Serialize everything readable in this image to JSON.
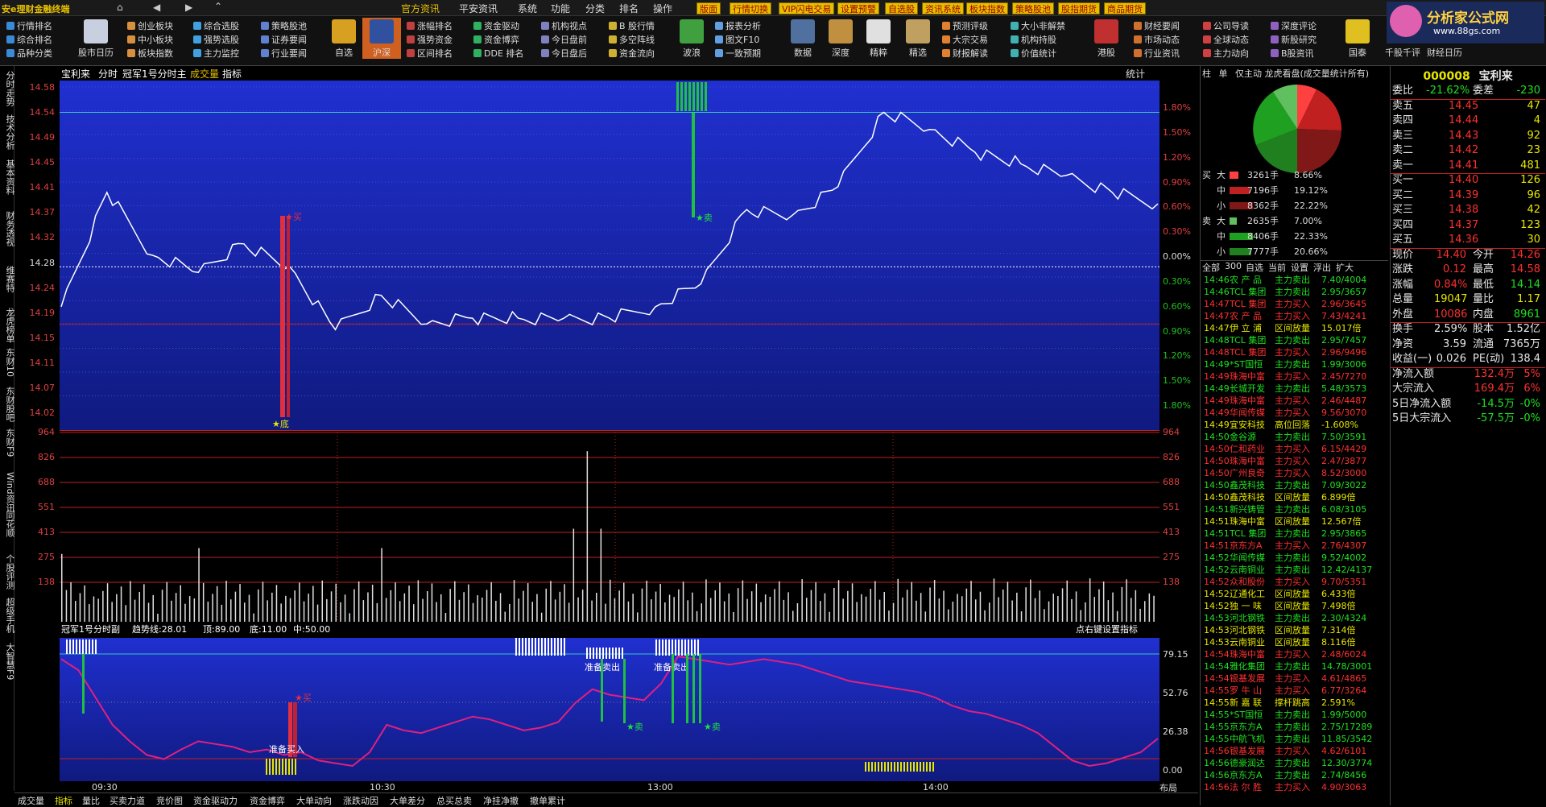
{
  "app": {
    "title": "安e理财金融终端",
    "menu": [
      "官方资讯",
      "平安资讯",
      "系统",
      "功能",
      "分类",
      "排名",
      "操作"
    ],
    "tags": [
      "版面",
      "行情切换",
      "VIP闪电交易",
      "设置预警",
      "自选股",
      "资讯系统",
      "板块指数",
      "策略股池",
      "股指期货",
      "商品期货"
    ]
  },
  "toolbar": {
    "col1": [
      "行情排名",
      "综合排名",
      "品种分类"
    ],
    "b1": "股市日历",
    "col2": [
      "创业板块",
      "中小板块",
      "板块指数"
    ],
    "col3": [
      "综合选股",
      "强势选股",
      "主力监控"
    ],
    "col4": [
      "策略股池",
      "证券要闻",
      "行业要闻"
    ],
    "b2": "自选",
    "b3": "沪深",
    "col5": [
      "涨幅排名",
      "强势资金",
      "区间排名"
    ],
    "col6": [
      "资金驱动",
      "资金博弈",
      "DDE 排名"
    ],
    "col7": [
      "机构视点",
      "今日盘前",
      "今日盘后"
    ],
    "col8": [
      "B 股行情",
      "多空阵线",
      "资金流向"
    ],
    "b4": "波浪",
    "col9": [
      "报表分析",
      "图文F10",
      "一致预期"
    ],
    "b5": "数据",
    "b6": "深度",
    "b7": "精粹",
    "b8": "精选",
    "col10": [
      "预测评级",
      "大宗交易",
      "财报解读"
    ],
    "col11": [
      "大小非解禁",
      "机构持股",
      "价值统计"
    ],
    "b9": "港股",
    "col12": [
      "财经要闻",
      "市场动态",
      "行业资讯"
    ],
    "col13": [
      "公司导读",
      "全球动态",
      "主力动向"
    ],
    "col14": [
      "深度评论",
      "新股研究",
      "B股资讯"
    ],
    "b10": "国泰",
    "b11": "千股千评",
    "b12": "财经日历",
    "logo": "分析家公式网",
    "logo_url": "www.88gs.com"
  },
  "leftnav": [
    "分时走势",
    "技术分析",
    "基本资料",
    "财务透视",
    "维赛特",
    "龙虎榜单",
    "东财10",
    "东财股吧",
    "东财F9",
    "Wind资讯",
    "同花顺",
    "个股评测",
    "超级手机",
    "大智慧F9"
  ],
  "main": {
    "header": {
      "stock": "宝利来",
      "mode": "分时",
      "indicator": "冠军1号分时主",
      "vol": "成交量",
      "ind": "指标",
      "stat": "统计"
    },
    "price_left": [
      "14.58",
      "14.54",
      "14.49",
      "14.45",
      "14.41",
      "14.37",
      "14.32",
      "14.28",
      "14.24",
      "14.19",
      "14.15",
      "14.11",
      "14.07",
      "14.02"
    ],
    "price_right": [
      "1.80%",
      "1.50%",
      "1.20%",
      "0.90%",
      "0.60%",
      "0.30%",
      "0.00%",
      "0.30%",
      "0.60%",
      "0.90%",
      "1.20%",
      "1.50%",
      "1.80%"
    ],
    "vol_axis": [
      "964",
      "826",
      "688",
      "551",
      "413",
      "275",
      "138"
    ],
    "sub_header": {
      "name": "冠军1号分时副",
      "trend": "趋势线:28.01",
      "top": "顶:89.00",
      "bottom": "底:11.00",
      "mid": "中:50.00",
      "hint": "点右键设置指标"
    },
    "sub_axis": [
      "79.15",
      "52.76",
      "26.38",
      "0.00"
    ],
    "time_axis": [
      "09:30",
      "10:30",
      "13:00",
      "14:00"
    ],
    "labels": {
      "low": "★底",
      "buy1": "★买",
      "sell1": "★卖",
      "prep_buy": "准备买入",
      "prep_sell1": "准备卖出",
      "prep_sell2": "准备卖出",
      "sub_buy": "★买",
      "sub_sell1": "★卖",
      "sub_sell2": "★卖"
    },
    "layout_tab": "布局"
  },
  "chart_data": {
    "type": "line",
    "title": "宝利来 分时",
    "prev_close": 14.28,
    "x": [
      "09:30",
      "09:40",
      "09:50",
      "10:00",
      "10:10",
      "10:20",
      "10:30",
      "10:40",
      "10:50",
      "11:00",
      "11:10",
      "11:20",
      "11:30/13:00",
      "13:10",
      "13:20",
      "13:30",
      "13:40",
      "13:50",
      "14:00",
      "14:10",
      "14:20",
      "14:30",
      "14:40",
      "14:50",
      "15:00"
    ],
    "series": [
      {
        "values": [
          14.21,
          14.41,
          14.3,
          14.27,
          14.32,
          14.28,
          14.17,
          14.23,
          14.18,
          14.19,
          14.19,
          14.19,
          14.19,
          14.21,
          14.25,
          14.38,
          14.37,
          14.42,
          14.55,
          14.52,
          14.48,
          14.46,
          14.44,
          14.41,
          14.39
        ]
      }
    ],
    "volume_ylim": [
      0,
      964
    ],
    "sub_ylim": [
      0,
      100
    ]
  },
  "pie": {
    "header": [
      "柱",
      "单",
      "仅主动",
      "龙虎看盘(成交量统计所有)"
    ]
  },
  "flows": {
    "buy_label": [
      "买",
      "入"
    ],
    "sell_label": [
      "卖",
      "出"
    ],
    "rows": [
      {
        "side": "买",
        "size": "大",
        "hands": "3261手",
        "pct": "8.66%"
      },
      {
        "side": "",
        "size": "中",
        "hands": "7196手",
        "pct": "19.12%"
      },
      {
        "side": "",
        "size": "小",
        "hands": "8362手",
        "pct": "22.22%"
      },
      {
        "side": "卖",
        "size": "大",
        "hands": "2635手",
        "pct": "7.00%"
      },
      {
        "side": "",
        "size": "中",
        "hands": "8406手",
        "pct": "22.33%"
      },
      {
        "side": "",
        "size": "小",
        "hands": "7777手",
        "pct": "20.66%"
      }
    ],
    "filters": [
      "全部",
      "300",
      "自选",
      "当前",
      "设置",
      "浮出",
      "扩大"
    ]
  },
  "trades": [
    [
      "14:46",
      "农 产 品",
      "主力卖出",
      "7.40/4004"
    ],
    [
      "14:46",
      "TCL 集团",
      "主力卖出",
      "2.95/3657"
    ],
    [
      "14:47",
      "TCL 集团",
      "主力买入",
      "2.96/3645"
    ],
    [
      "14:47",
      "农 产 品",
      "主力买入",
      "7.43/4241"
    ],
    [
      "14:47",
      "伊 立 浦",
      "区间放量",
      "15.017倍"
    ],
    [
      "14:48",
      "TCL 集团",
      "主力卖出",
      "2.95/7457"
    ],
    [
      "14:48",
      "TCL 集团",
      "主力买入",
      "2.96/9496"
    ],
    [
      "14:49",
      "*ST国恒",
      "主力卖出",
      "1.99/3006"
    ],
    [
      "14:49",
      "珠海中富",
      "主力买入",
      "2.45/7270"
    ],
    [
      "14:49",
      "长城开发",
      "主力卖出",
      "5.48/3573"
    ],
    [
      "14:49",
      "珠海中富",
      "主力买入",
      "2.46/4487"
    ],
    [
      "14:49",
      "华闻传媒",
      "主力买入",
      "9.56/3070"
    ],
    [
      "14:49",
      "宜安科技",
      "高位回落",
      "-1.608%"
    ],
    [
      "14:50",
      "金谷源",
      "主力卖出",
      "7.50/3591"
    ],
    [
      "14:50",
      "仁和药业",
      "主力买入",
      "6.15/4429"
    ],
    [
      "14:50",
      "珠海中富",
      "主力买入",
      "2.47/3877"
    ],
    [
      "14:50",
      "广州良奇",
      "主力买入",
      "8.52/3000"
    ],
    [
      "14:50",
      "鑫茂科技",
      "主力卖出",
      "7.09/3022"
    ],
    [
      "14:50",
      "鑫茂科技",
      "区间放量",
      "6.899倍"
    ],
    [
      "14:51",
      "新兴铸管",
      "主力卖出",
      "6.08/3105"
    ],
    [
      "14:51",
      "珠海中富",
      "区间放量",
      "12.567倍"
    ],
    [
      "14:51",
      "TCL 集团",
      "主力卖出",
      "2.95/3865"
    ],
    [
      "14:51",
      "京东方A",
      "主力买入",
      "2.76/4307"
    ],
    [
      "14:52",
      "华闻传媒",
      "主力卖出",
      "9.52/4002"
    ],
    [
      "14:52",
      "云南铜业",
      "主力卖出",
      "12.42/4137"
    ],
    [
      "14:52",
      "众和股份",
      "主力买入",
      "9.70/5351"
    ],
    [
      "14:52",
      "辽通化工",
      "区间放量",
      "6.433倍"
    ],
    [
      "14:52",
      "独 一 味",
      "区间放量",
      "7.498倍"
    ],
    [
      "14:53",
      "河北钢铁",
      "主力卖出",
      "2.30/4324"
    ],
    [
      "14:53",
      "河北钢铁",
      "区间放量",
      "7.314倍"
    ],
    [
      "14:53",
      "云南铜业",
      "区间放量",
      "8.116倍"
    ],
    [
      "14:54",
      "珠海中富",
      "主力买入",
      "2.48/6024"
    ],
    [
      "14:54",
      "雅化集团",
      "主力卖出",
      "14.78/3001"
    ],
    [
      "14:54",
      "银基发展",
      "主力买入",
      "4.61/4865"
    ],
    [
      "14:55",
      "罗 牛 山",
      "主力买入",
      "6.77/3264"
    ],
    [
      "14:55",
      "新 嘉 联",
      "撑杆跳高",
      "2.591%"
    ],
    [
      "14:55",
      "*ST国恒",
      "主力卖出",
      "1.99/5000"
    ],
    [
      "14:55",
      "京东方A",
      "主力卖出",
      "2.75/17289"
    ],
    [
      "14:55",
      "中航飞机",
      "主力卖出",
      "11.85/3542"
    ],
    [
      "14:56",
      "银基发展",
      "主力买入",
      "4.62/6101"
    ],
    [
      "14:56",
      "德豪润达",
      "主力卖出",
      "12.30/3774"
    ],
    [
      "14:56",
      "京东方A",
      "主力卖出",
      "2.74/8456"
    ],
    [
      "14:56",
      "法 尔 胜",
      "主力买入",
      "4.90/3063"
    ]
  ],
  "quote": {
    "code": "000008",
    "name": "宝利来",
    "wb": {
      "label": "委比",
      "value": "-21.62%",
      "label2": "委差",
      "value2": "-230"
    },
    "asks": [
      [
        "卖五",
        "14.45",
        "47"
      ],
      [
        "卖四",
        "14.44",
        "4"
      ],
      [
        "卖三",
        "14.43",
        "92"
      ],
      [
        "卖二",
        "14.42",
        "23"
      ],
      [
        "卖一",
        "14.41",
        "481"
      ]
    ],
    "bids": [
      [
        "买一",
        "14.40",
        "126"
      ],
      [
        "买二",
        "14.39",
        "96"
      ],
      [
        "买三",
        "14.38",
        "42"
      ],
      [
        "买四",
        "14.37",
        "123"
      ],
      [
        "买五",
        "14.36",
        "30"
      ]
    ],
    "stats": [
      [
        "现价",
        "14.40",
        "今开",
        "14.26"
      ],
      [
        "涨跌",
        "0.12",
        "最高",
        "14.58"
      ],
      [
        "涨幅",
        "0.84%",
        "最低",
        "14.14"
      ],
      [
        "总量",
        "19047",
        "量比",
        "1.17"
      ],
      [
        "外盘",
        "10086",
        "内盘",
        "8961"
      ]
    ],
    "stats2": [
      [
        "换手",
        "2.59%",
        "股本",
        "1.52亿"
      ],
      [
        "净资",
        "3.59",
        "流通",
        "7365万"
      ],
      [
        "收益(一)",
        "0.026",
        "PE(动)",
        "138.4"
      ]
    ],
    "flow": [
      [
        "净流入额",
        "132.4万",
        "5%"
      ],
      [
        "大宗流入",
        "169.4万",
        "6%"
      ],
      [
        "5日净流入额",
        "-14.5万",
        "-0%"
      ],
      [
        "5日大宗流入",
        "-57.5万",
        "-0%"
      ]
    ]
  },
  "bottom_tabs": [
    "成交量",
    "指标",
    "量比",
    "买卖力道",
    "竞价图",
    "资金驱动力",
    "资金博弈",
    "大单动向",
    "涨跌动因",
    "大单差分",
    "总买总卖",
    "净挂净撤",
    "撤单累计"
  ],
  "colors": {
    "accent": "#e6c000",
    "up": "#ff3030",
    "down": "#20e020",
    "bg_chart": "#1a2ab8"
  }
}
